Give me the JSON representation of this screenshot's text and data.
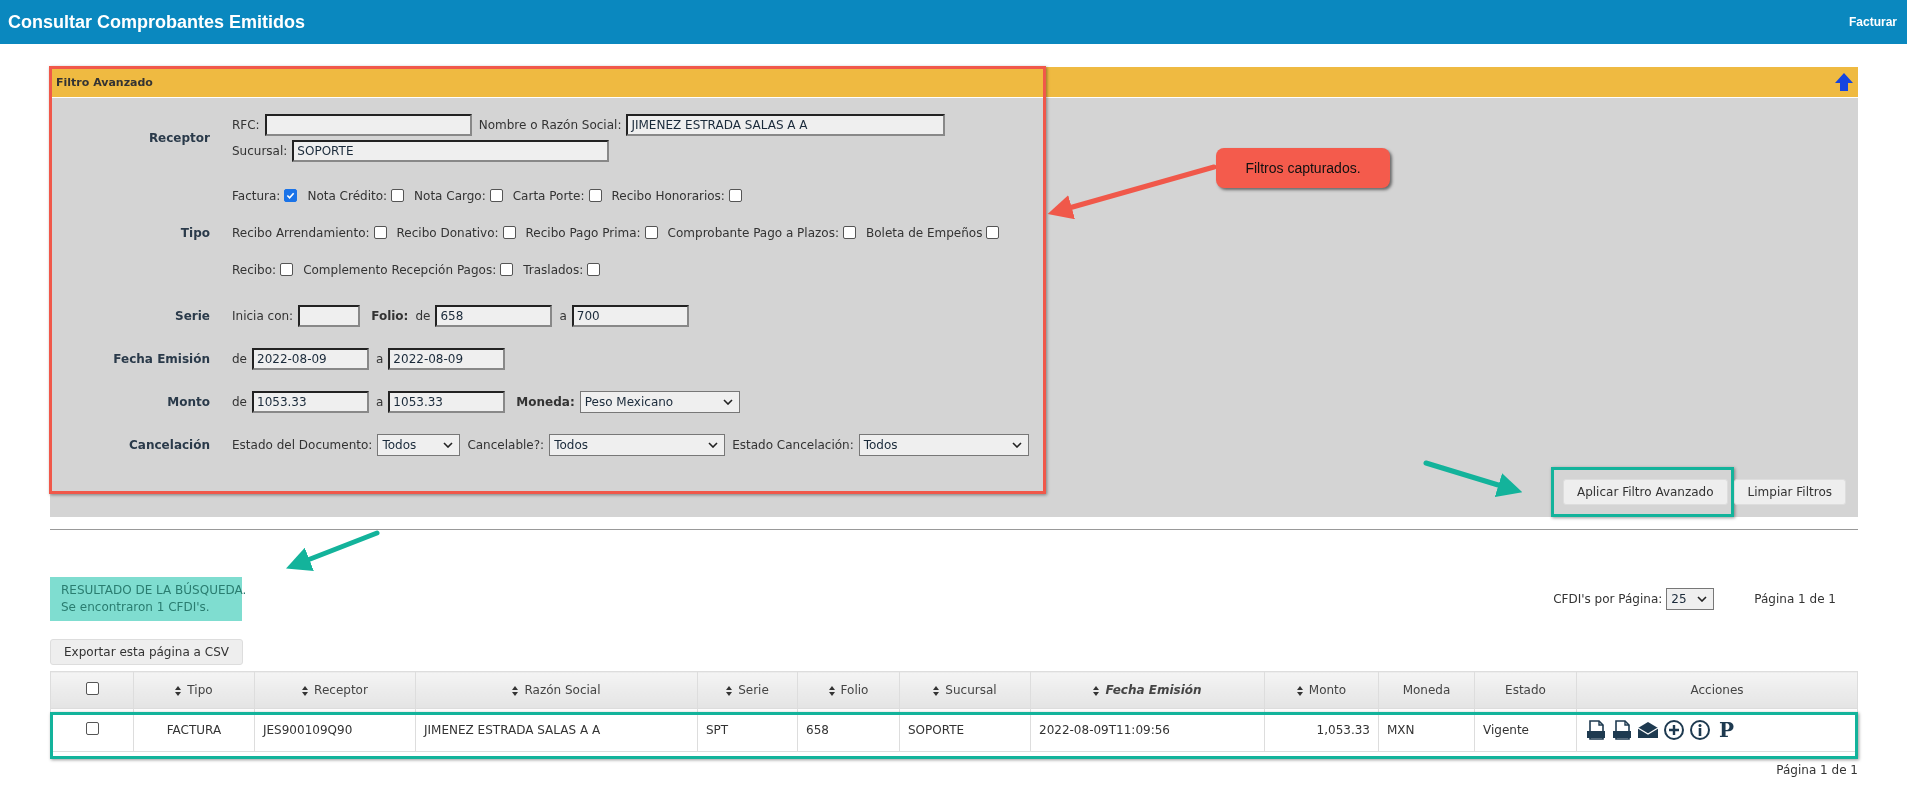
{
  "header": {
    "title": "Consultar Comprobantes Emitidos",
    "link": "Facturar"
  },
  "filter": {
    "title": "Filtro Avanzado",
    "rows": [
      {
        "label": "Receptor",
        "lines": [
          [
            {
              "kind": "label",
              "text": "RFC:"
            },
            {
              "kind": "input"
            },
            {
              "kind": "label",
              "text": "Nombre o Razón Social:"
            },
            {
              "kind": "input",
              "value": "JIMENEZ ESTRADA SALAS A A"
            }
          ],
          [
            {
              "kind": "label",
              "text": "Sucursal:"
            },
            {
              "kind": "input",
              "value": "SOPORTE"
            }
          ]
        ]
      },
      {
        "label": "Tipo",
        "lines": [
          [
            {
              "kind": "check",
              "text": "Factura:",
              "checked": true
            },
            {
              "kind": "check",
              "text": "Nota Crédito:",
              "checked": false
            },
            {
              "kind": "check",
              "text": "Nota Cargo:",
              "checked": false
            },
            {
              "kind": "check",
              "text": "Carta Porte:",
              "checked": false
            },
            {
              "kind": "check",
              "text": "Recibo Honorarios:",
              "checked": false
            }
          ],
          [
            {
              "kind": "check",
              "text": "Recibo Arrendamiento:",
              "checked": false
            },
            {
              "kind": "check",
              "text": "Recibo Donativo:",
              "checked": false
            },
            {
              "kind": "check",
              "text": "Recibo Pago Prima:",
              "checked": false
            },
            {
              "kind": "check",
              "text": "Comprobante Pago a Plazos:",
              "checked": false
            },
            {
              "kind": "check",
              "text": "Boleta de Empeños",
              "checked": false
            }
          ],
          [
            {
              "kind": "check",
              "text": "Recibo:",
              "checked": false
            },
            {
              "kind": "check",
              "text": "Complemento Recepción Pagos:",
              "checked": false
            },
            {
              "kind": "check",
              "text": "Traslados:",
              "checked": false
            }
          ]
        ]
      },
      {
        "label": "Serie",
        "lines": [
          [
            {
              "kind": "label",
              "text": "Inicia con:"
            },
            {
              "kind": "input"
            },
            {
              "kind": "strong",
              "text": "Folio:"
            },
            {
              "kind": "label",
              "text": "de"
            },
            {
              "kind": "input",
              "value": "658"
            },
            {
              "kind": "label",
              "text": "a"
            },
            {
              "kind": "input",
              "value": "700"
            }
          ]
        ]
      },
      {
        "label": "Fecha Emisión",
        "lines": [
          [
            {
              "kind": "label",
              "text": "de"
            },
            {
              "kind": "input",
              "value": "2022-08-09"
            },
            {
              "kind": "label",
              "text": "a"
            },
            {
              "kind": "input",
              "value": "2022-08-09"
            }
          ]
        ]
      },
      {
        "label": "Monto",
        "lines": [
          [
            {
              "kind": "label",
              "text": "de"
            },
            {
              "kind": "input",
              "value": "1053.33"
            },
            {
              "kind": "label",
              "text": "a"
            },
            {
              "kind": "input",
              "value": "1053.33"
            },
            {
              "kind": "strong",
              "text": "Moneda:"
            },
            {
              "kind": "select",
              "value": "Peso Mexicano"
            }
          ]
        ]
      },
      {
        "label": "Cancelación",
        "lines": [
          [
            {
              "kind": "label",
              "text": "Estado del Documento:"
            },
            {
              "kind": "select",
              "value": "Todos"
            },
            {
              "kind": "label",
              "text": "Cancelable?:"
            },
            {
              "kind": "select",
              "value": "Todos"
            },
            {
              "kind": "label",
              "text": "Estado Cancelación:"
            },
            {
              "kind": "select",
              "value": "Todos"
            }
          ]
        ]
      }
    ],
    "buttons": [
      "Aplicar Filtro Avanzado",
      "Limpiar Filtros"
    ]
  },
  "result": {
    "lines": [
      "RESULTADO DE LA BÚSQUEDA.",
      "Se encontraron 1 CFDI's."
    ],
    "per_page_label": "CFDI's por Página:",
    "per_page": "25",
    "page_top": "Página 1 de 1",
    "export": "Exportar esta página a CSV",
    "page_bottom": "Página 1 de 1"
  },
  "table": {
    "header_checked": false,
    "columns": [
      {
        "label": "Tipo",
        "sortable": true,
        "sorted": false
      },
      {
        "label": "Receptor",
        "sortable": true,
        "sorted": false
      },
      {
        "label": "Razón Social",
        "sortable": true,
        "sorted": false
      },
      {
        "label": "Serie",
        "sortable": true,
        "sorted": false
      },
      {
        "label": "Folio",
        "sortable": true,
        "sorted": false
      },
      {
        "label": "Sucursal",
        "sortable": true,
        "sorted": false
      },
      {
        "label": "Fecha Emisión",
        "sortable": true,
        "sorted": true
      },
      {
        "label": "Monto",
        "sortable": true,
        "sorted": false
      },
      {
        "label": "Moneda",
        "sortable": false,
        "sorted": false
      },
      {
        "label": "Estado",
        "sortable": false,
        "sorted": false
      },
      {
        "label": "Acciones",
        "sortable": false,
        "sorted": false
      }
    ],
    "rows": [
      {
        "checked": false,
        "cells": [
          "FACTURA",
          "JES900109Q90",
          "JIMENEZ ESTRADA SALAS A A",
          "SPT",
          "658",
          "SOPORTE",
          "2022-08-09T11:09:56",
          "1,053.33",
          "MXN",
          "Vigente"
        ],
        "actions": [
          {
            "kind": "file"
          },
          {
            "kind": "file"
          },
          {
            "kind": "mail"
          },
          {
            "kind": "add"
          },
          {
            "kind": "info"
          },
          {
            "kind": "glyph",
            "text": "P"
          }
        ]
      }
    ]
  },
  "annotation": {
    "callout": "Filtros capturados."
  }
}
